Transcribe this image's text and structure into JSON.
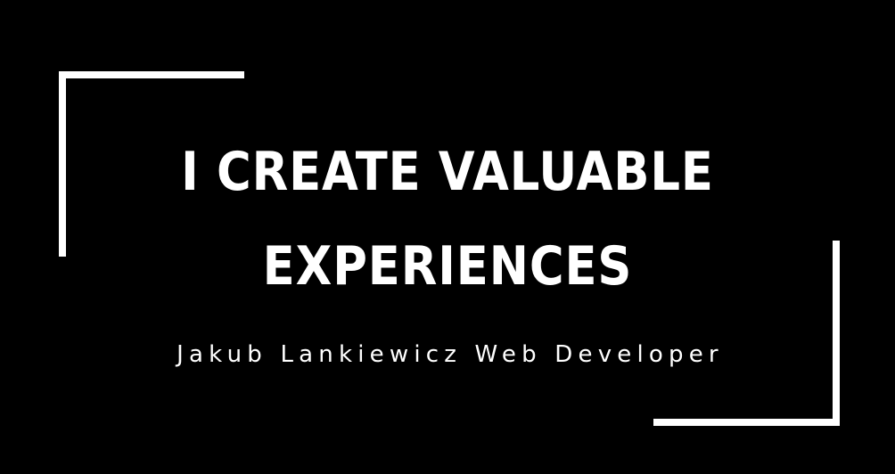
{
  "hero": {
    "headline_line1": "I CREATE VALUABLE",
    "headline_line2": "EXPERIENCES",
    "tagline": "Jakub Lankiewicz Web Developer"
  },
  "colors": {
    "background": "#000000",
    "foreground": "#ffffff"
  }
}
